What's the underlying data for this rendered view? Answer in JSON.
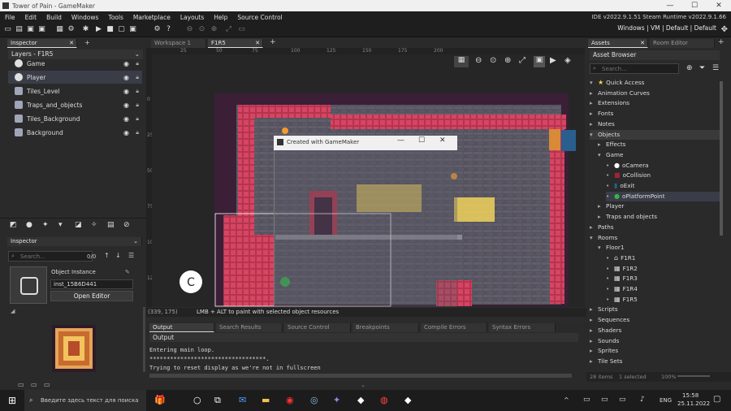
{
  "window": {
    "title": "Tower of Pain - GameMaker",
    "controls": [
      "—",
      "☐",
      "✕"
    ]
  },
  "menu": [
    "File",
    "Edit",
    "Build",
    "Windows",
    "Tools",
    "Marketplace",
    "Layouts",
    "Help",
    "Source Control"
  ],
  "ide_version": "IDE v2022.9.1.51 Steam  Runtime v2022.9.1.66",
  "target": "Windows | VM | Default | Default",
  "left_panel": {
    "tab": "Inspector",
    "layers_title": "Layers - F1R5",
    "layers": [
      {
        "name": "Game",
        "icon": "instance-layer-icon",
        "selected": false
      },
      {
        "name": "Player",
        "icon": "instance-layer-icon",
        "selected": true
      },
      {
        "name": "Tiles_Level",
        "icon": "tile-layer-icon",
        "selected": false
      },
      {
        "name": "Traps_and_objects",
        "icon": "tile-layer-icon",
        "selected": false
      },
      {
        "name": "Tiles_Background",
        "icon": "tile-layer-icon",
        "selected": false
      },
      {
        "name": "Background",
        "icon": "background-layer-icon",
        "selected": false
      }
    ],
    "inspector_title": "Inspector",
    "search_placeholder": "Search...",
    "count": "0/0",
    "object_instance_label": "Object Instance",
    "instance_name": "inst_15B6D441",
    "open_editor": "Open Editor"
  },
  "room_tabs": [
    "Workspace 1",
    "F1R5"
  ],
  "ruler_top": [
    "25",
    "50",
    "75",
    "100",
    "125",
    "150",
    "175",
    "200"
  ],
  "ruler_left": [
    "0",
    "25",
    "50",
    "75",
    "100",
    "125"
  ],
  "status_bar": {
    "coords": "(339, 175)",
    "hint": "LMB + ALT to paint with selected object resources"
  },
  "game_window_title": "Created with GameMaker",
  "output": {
    "tabs": [
      "Output",
      "Search Results",
      "Source Control",
      "Breakpoints",
      "Compile Errors",
      "Syntax Errors"
    ],
    "header": "Output",
    "lines": [
      "Entering main loop.",
      "**********************************.",
      "Trying to reset display as we're not in fullscreen"
    ]
  },
  "asset_browser": {
    "tabs": [
      "Assets",
      "Room Editor"
    ],
    "title": "Asset Browser",
    "search_placeholder": "Search...",
    "items": [
      {
        "label": "Quick Access",
        "depth": 0,
        "open": true,
        "kind": "star"
      },
      {
        "label": "Animation Curves",
        "depth": 0,
        "open": false,
        "kind": "folder"
      },
      {
        "label": "Extensions",
        "depth": 0,
        "open": false,
        "kind": "folder"
      },
      {
        "label": "Fonts",
        "depth": 0,
        "open": false,
        "kind": "folder"
      },
      {
        "label": "Notes",
        "depth": 0,
        "open": false,
        "kind": "folder"
      },
      {
        "label": "Objects",
        "depth": 0,
        "open": true,
        "kind": "folder",
        "highlight": true
      },
      {
        "label": "Effects",
        "depth": 1,
        "open": false,
        "kind": "folder"
      },
      {
        "label": "Game",
        "depth": 1,
        "open": true,
        "kind": "folder"
      },
      {
        "label": "oCamera",
        "depth": 2,
        "kind": "camera"
      },
      {
        "label": "oCollision",
        "depth": 2,
        "kind": "collision"
      },
      {
        "label": "oExit",
        "depth": 2,
        "kind": "exit"
      },
      {
        "label": "oPlatformPoint",
        "depth": 2,
        "kind": "platform",
        "selected": true
      },
      {
        "label": "Player",
        "depth": 1,
        "open": false,
        "kind": "folder"
      },
      {
        "label": "Traps and objects",
        "depth": 1,
        "open": false,
        "kind": "folder"
      },
      {
        "label": "Paths",
        "depth": 0,
        "open": false,
        "kind": "folder"
      },
      {
        "label": "Rooms",
        "depth": 0,
        "open": true,
        "kind": "folder"
      },
      {
        "label": "Floor1",
        "depth": 1,
        "open": true,
        "kind": "folder"
      },
      {
        "label": "F1R1",
        "depth": 2,
        "kind": "room",
        "home": true
      },
      {
        "label": "F1R2",
        "depth": 2,
        "kind": "room"
      },
      {
        "label": "F1R3",
        "depth": 2,
        "kind": "room"
      },
      {
        "label": "F1R4",
        "depth": 2,
        "kind": "room"
      },
      {
        "label": "F1R5",
        "depth": 2,
        "kind": "room"
      },
      {
        "label": "Scripts",
        "depth": 0,
        "open": false,
        "kind": "folder"
      },
      {
        "label": "Sequences",
        "depth": 0,
        "open": false,
        "kind": "folder"
      },
      {
        "label": "Shaders",
        "depth": 0,
        "open": false,
        "kind": "folder"
      },
      {
        "label": "Sounds",
        "depth": 0,
        "open": false,
        "kind": "folder"
      },
      {
        "label": "Sprites",
        "depth": 0,
        "open": false,
        "kind": "folder"
      },
      {
        "label": "Tile Sets",
        "depth": 0,
        "open": false,
        "kind": "folder"
      }
    ],
    "footer_items": "28 items",
    "footer_selected": "1 selected",
    "zoom": "100%"
  },
  "taskbar": {
    "search_placeholder": "Введите здесь текст для поиска",
    "lang": "ENG",
    "time": "15:58",
    "date": "25.11.2022"
  }
}
